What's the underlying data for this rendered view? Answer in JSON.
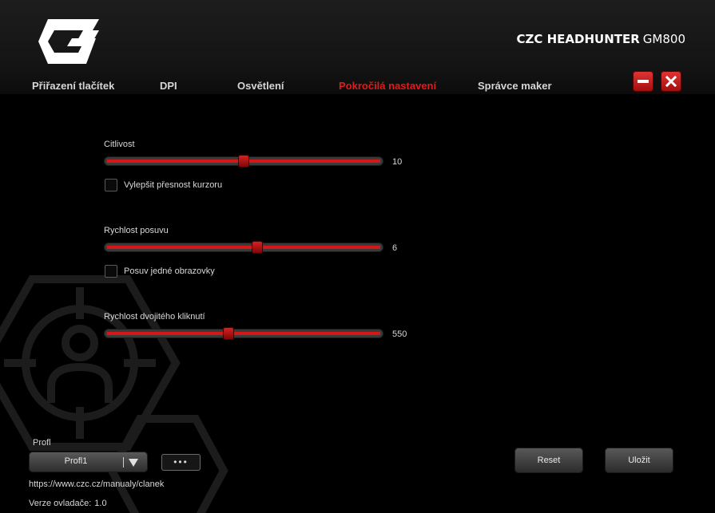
{
  "header": {
    "brand_name": "CZC HEADHUNTER",
    "brand_model": "GM800",
    "tabs": [
      {
        "label": "Přiřazení tlačítek",
        "active": false
      },
      {
        "label": "DPI",
        "active": false
      },
      {
        "label": "Osvětlení",
        "active": false
      },
      {
        "label": "Pokročilá nastavení",
        "active": true
      },
      {
        "label": "Správce maker",
        "active": false
      }
    ],
    "window_buttons": [
      "minimize-icon",
      "close-icon"
    ]
  },
  "settings": {
    "sensitivity": {
      "label": "Citlivost",
      "value": "10",
      "fraction": 0.5
    },
    "enhance_precision": {
      "label": "Vylepšit přesnost kurzoru",
      "checked": false
    },
    "scroll_speed": {
      "label": "Rychlost posuvu",
      "value": "6",
      "fraction": 0.548
    },
    "scroll_one_screen": {
      "label": "Posuv jedné obrazovky",
      "checked": false
    },
    "double_click_speed": {
      "label": "Rychlost dvojitého kliknutí",
      "value": "550",
      "fraction": 0.446
    }
  },
  "footer": {
    "profile_label": "Profl",
    "profile_value": "Profl1",
    "more_label": "•••",
    "reset_label": "Reset",
    "save_label": "Uložit",
    "url": "https://www.czc.cz/manualy/clanek",
    "version_label": "Verze ovladače:",
    "version_value": "1.0"
  },
  "colors": {
    "accent": "#e01b1b",
    "background": "#000000",
    "header": "#1a1a1a"
  }
}
